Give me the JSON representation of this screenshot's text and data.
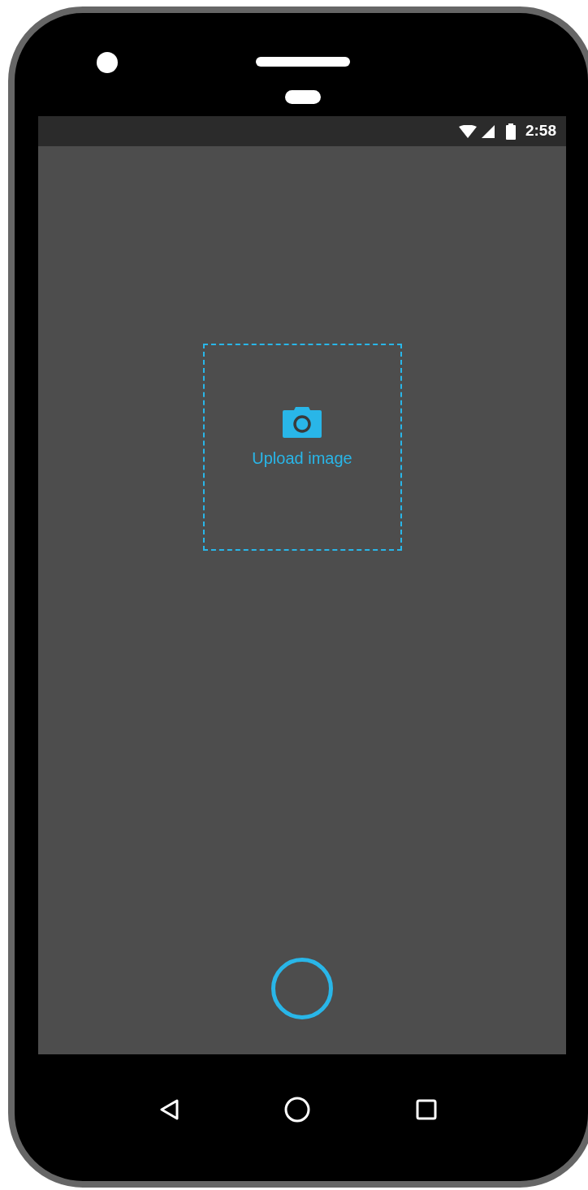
{
  "status_bar": {
    "time": "2:58"
  },
  "upload": {
    "label": "Upload image"
  }
}
